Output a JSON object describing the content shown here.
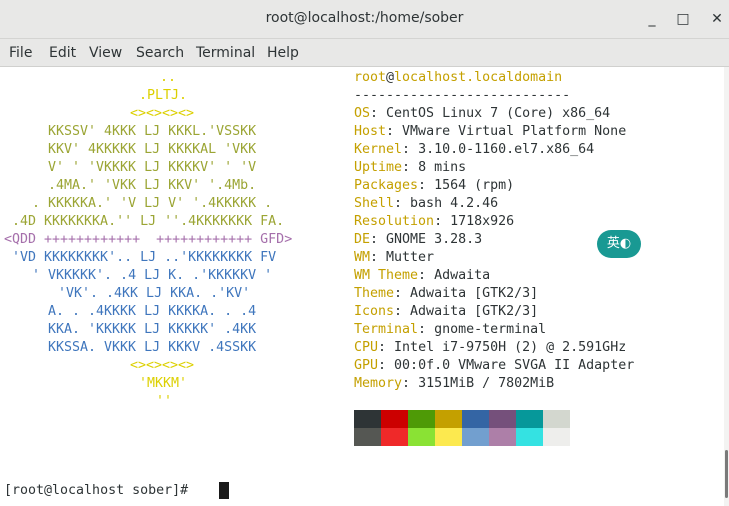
{
  "window": {
    "title": "root@localhost:/home/sober",
    "controls": {
      "minimize": "_",
      "maximize": "□",
      "close": "✕"
    }
  },
  "menubar": [
    "File",
    "Edit",
    "View",
    "Search",
    "Terminal",
    "Help"
  ],
  "logo_lines": [
    "..",
    ".PLTJ.",
    "<><><><>",
    "KKSSV' 4KKK LJ KKKL.'VSSKK",
    "KKV' 4KKKKK LJ KKKKAL 'VKK",
    "V' ' 'VKKKK LJ KKKKV' ' 'V",
    ".4MA.' 'VKK LJ KKV' '.4Mb.",
    ". KKKKKA.' 'V LJ V' '.4KKKKK .",
    ".4D KKKKKKKA.'' LJ ''.4KKKKKKK FA.",
    "<QDD ++++++++++++  ++++++++++++ GFD>",
    "'VD KKKKKKKK'.. LJ ..'KKKKKKKK FV",
    "' VKKKKK'. .4 LJ K. .'KKKKKV '",
    "'VK'. .4KK LJ KKA. .'KV'",
    "A. . .4KKKK LJ KKKKA. . .4",
    "KKA. 'KKKKK LJ KKKKK' .4KK",
    "KKSSA. VKKK LJ KKKV .4SSKK",
    "<><><><>",
    "'MKKM'",
    "''"
  ],
  "sysinfo": {
    "user": "root",
    "at": "@",
    "host": "localhost.localdomain",
    "separator": "---------------------------",
    "fields": [
      {
        "key": "OS",
        "value": "CentOS Linux 7 (Core) x86_64"
      },
      {
        "key": "Host",
        "value": "VMware Virtual Platform None"
      },
      {
        "key": "Kernel",
        "value": "3.10.0-1160.el7.x86_64"
      },
      {
        "key": "Uptime",
        "value": "8 mins"
      },
      {
        "key": "Packages",
        "value": "1564 (rpm)"
      },
      {
        "key": "Shell",
        "value": "bash 4.2.46"
      },
      {
        "key": "Resolution",
        "value": "1718x926"
      },
      {
        "key": "DE",
        "value": "GNOME 3.28.3"
      },
      {
        "key": "WM",
        "value": "Mutter"
      },
      {
        "key": "WM Theme",
        "value": "Adwaita"
      },
      {
        "key": "Theme",
        "value": "Adwaita [GTK2/3]"
      },
      {
        "key": "Icons",
        "value": "Adwaita [GTK2/3]"
      },
      {
        "key": "Terminal",
        "value": "gnome-terminal"
      },
      {
        "key": "CPU",
        "value": "Intel i7-9750H (2) @ 2.591GHz"
      },
      {
        "key": "GPU",
        "value": "00:0f.0 VMware SVGA II Adapter"
      },
      {
        "key": "Memory",
        "value": "3151MiB / 7802MiB"
      }
    ],
    "key_color": "#c4a000",
    "palette_top": [
      "#2e3436",
      "#cc0000",
      "#4e9a06",
      "#c4a000",
      "#3465a4",
      "#75507b",
      "#06989a",
      "#d3d7cf"
    ],
    "palette_bottom": [
      "#555753",
      "#ef2929",
      "#8ae234",
      "#fce94f",
      "#729fcf",
      "#ad7fa8",
      "#34e2e2",
      "#eeeeec"
    ]
  },
  "prompt": "[root@localhost sober]# ",
  "ime_label": "英◐"
}
